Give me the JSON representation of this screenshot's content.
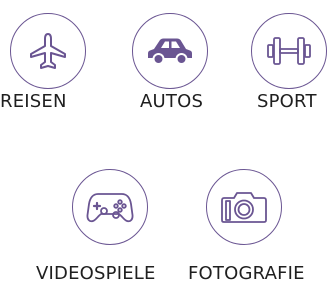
{
  "accent_color": "#6a5592",
  "categories": [
    {
      "label": "REISEN",
      "icon": "airplane-icon"
    },
    {
      "label": "AUTOS",
      "icon": "car-icon"
    },
    {
      "label": "SPORT",
      "icon": "dumbbell-icon"
    },
    {
      "label": "VIDEOSPIELE",
      "icon": "gamepad-icon"
    },
    {
      "label": "FOTOGRAFIE",
      "icon": "camera-icon"
    }
  ]
}
